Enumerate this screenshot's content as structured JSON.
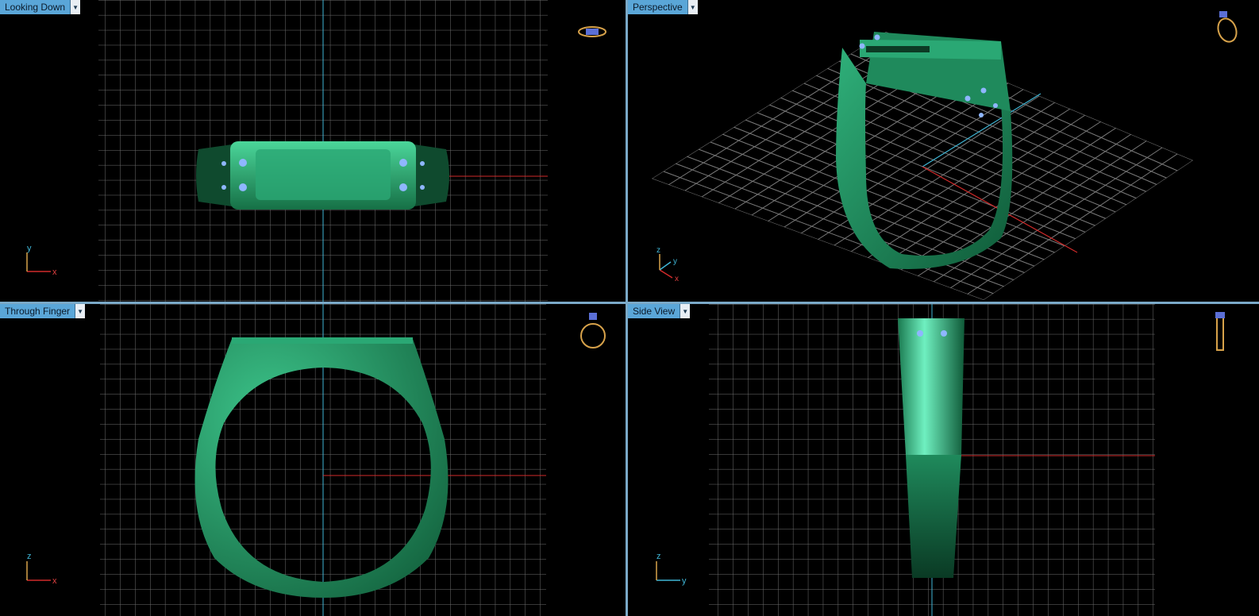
{
  "viewports": [
    {
      "label": "Looking Down",
      "axes": [
        "y",
        "x"
      ]
    },
    {
      "label": "Perspective",
      "axes": [
        "z",
        "y",
        "x"
      ]
    },
    {
      "label": "Through Finger",
      "axes": [
        "z",
        "x"
      ]
    },
    {
      "label": "Side View",
      "axes": [
        "z",
        "y"
      ]
    }
  ],
  "icons": {
    "dropdown": "chevron-down-icon",
    "ring_top": "ring-top-view-icon",
    "ring_persp": "ring-perspective-icon",
    "ring_front": "ring-front-view-icon",
    "ring_side": "ring-side-view-icon"
  },
  "colors": {
    "label_bg": "#5aa6d8",
    "grid": "#8a8a8a",
    "axis_x": "#d12a2a",
    "axis_y": "#3fb6d6",
    "ring": "#1f8a5c",
    "stone": "#8fb6ff"
  }
}
